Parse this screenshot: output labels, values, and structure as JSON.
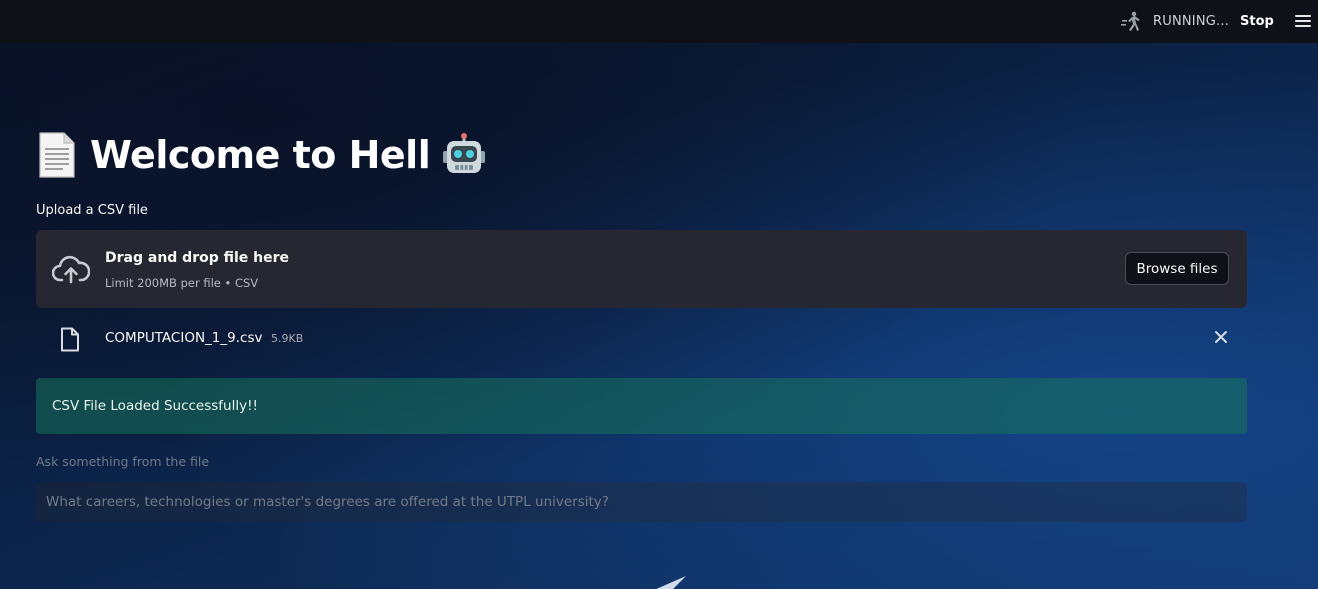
{
  "header": {
    "status": "RUNNING...",
    "stop_label": "Stop",
    "running_icon": "running-man-icon",
    "menu_icon": "hamburger-menu-icon"
  },
  "main": {
    "title_text": "Welcome to Hell",
    "title_leading_icon": "page-facing-up-icon",
    "title_trailing_icon": "robot-face-icon",
    "uploader": {
      "label": "Upload a CSV file",
      "drop_title": "Drag and drop file here",
      "drop_limit": "Limit 200MB per file • CSV",
      "browse_label": "Browse files",
      "icon": "cloud-upload-icon"
    },
    "uploaded_file": {
      "name": "COMPUTACION_1_9.csv",
      "size": "5.9KB",
      "icon": "file-icon"
    },
    "success_message": "CSV File Loaded Successfully!!",
    "question": {
      "label": "Ask something from the file",
      "value": "",
      "placeholder": "What careers, technologies or master's degrees are offered at the UTPL university?"
    }
  },
  "colors": {
    "header_bg": "#0e1117",
    "dropzone_bg": "#262730",
    "success_bg": "#17725b",
    "background": "#0b2246"
  }
}
